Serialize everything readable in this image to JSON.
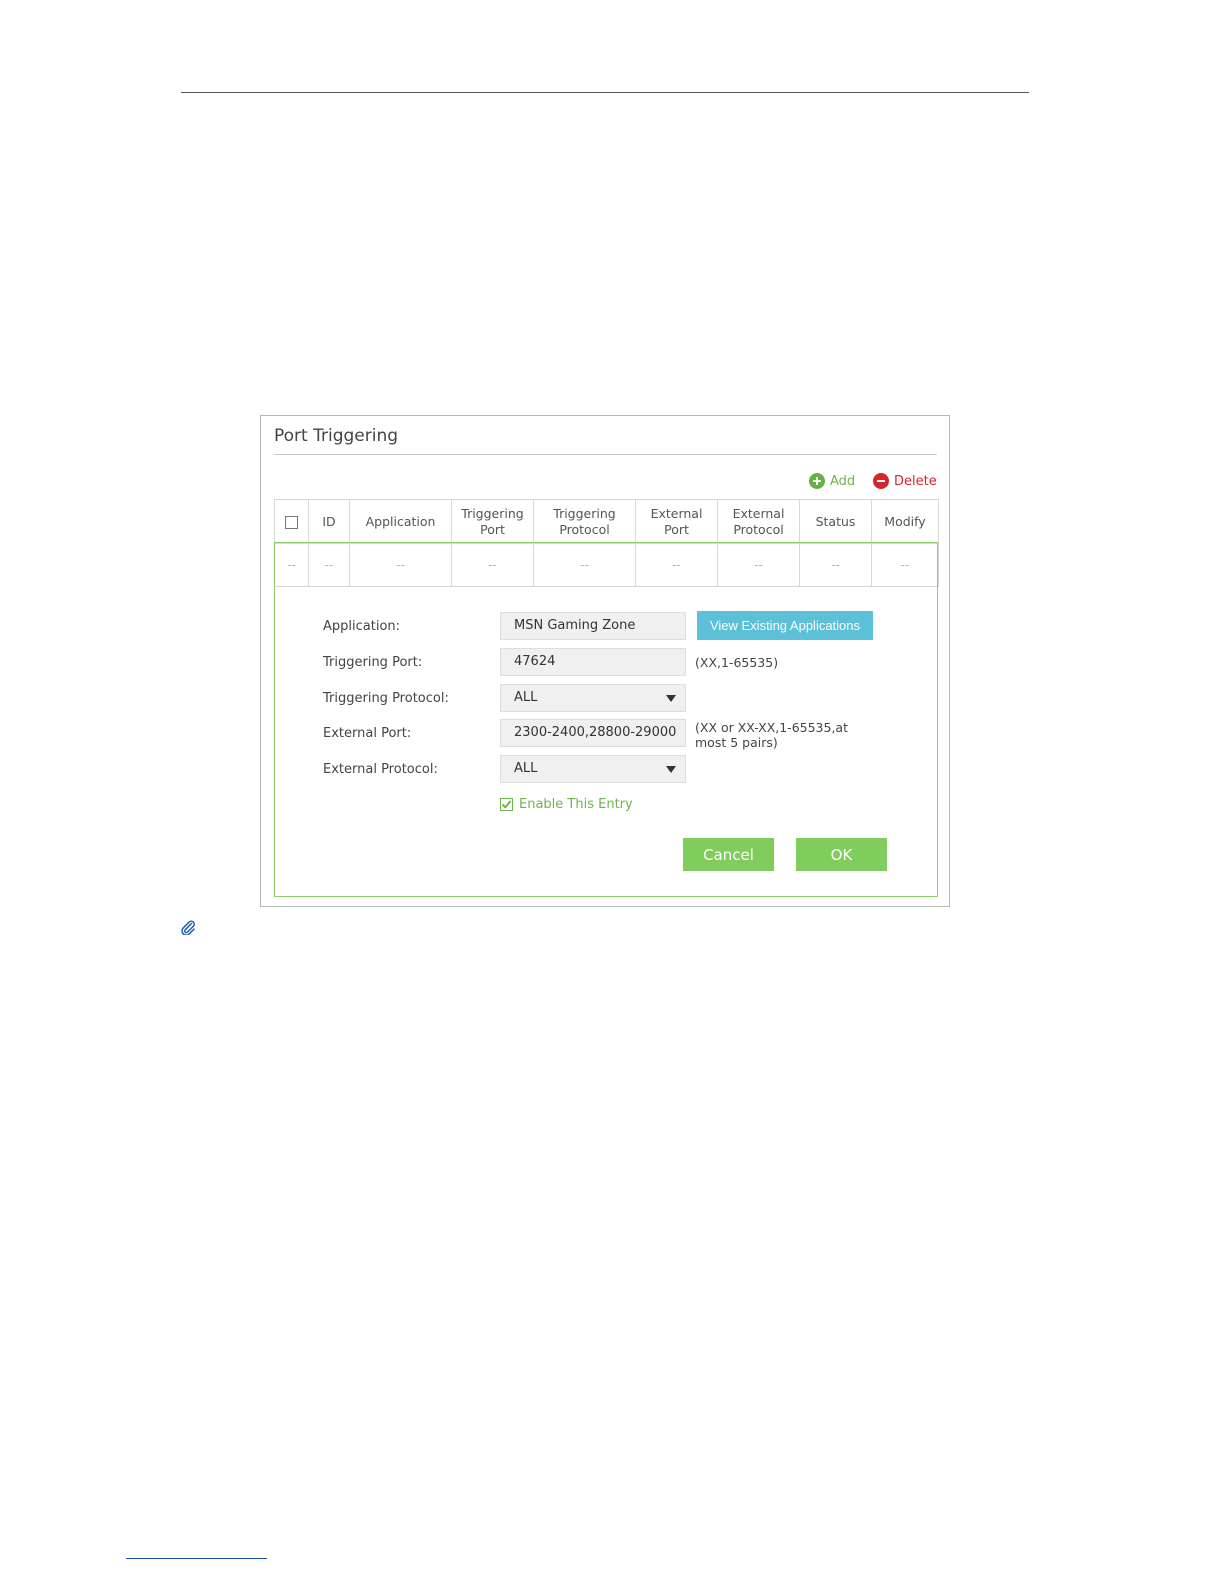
{
  "panel": {
    "title": "Port Triggering",
    "add_label": "Add",
    "delete_label": "Delete"
  },
  "table": {
    "headers": {
      "id": "ID",
      "application": "Application",
      "triggering_port_1": "Triggering",
      "triggering_port_2": "Port",
      "triggering_protocol_1": "Triggering",
      "triggering_protocol_2": "Protocol",
      "external_port_1": "External",
      "external_port_2": "Port",
      "external_protocol_1": "External",
      "external_protocol_2": "Protocol",
      "status": "Status",
      "modify": "Modify"
    },
    "empty_row": [
      "--",
      "--",
      "--",
      "--",
      "--",
      "--",
      "--",
      "--",
      "--"
    ]
  },
  "form": {
    "application_label": "Application:",
    "application_value": "MSN Gaming Zone",
    "view_apps_label": "View Existing Applications",
    "triggering_port_label": "Triggering Port:",
    "triggering_port_value": "47624",
    "triggering_port_hint": "(XX,1-65535)",
    "triggering_protocol_label": "Triggering Protocol:",
    "triggering_protocol_value": "ALL",
    "external_port_label": "External Port:",
    "external_port_value": "2300-2400,28800-29000",
    "external_port_hint_1": "(XX or XX-XX,1-65535,at",
    "external_port_hint_2": "most 5 pairs)",
    "external_protocol_label": "External Protocol:",
    "external_protocol_value": "ALL",
    "enable_label": "Enable This Entry",
    "enable_checked": true,
    "cancel_label": "Cancel",
    "ok_label": "OK"
  },
  "colors": {
    "accent_green": "#80cc5c",
    "delete_red": "#d5252f",
    "view_button_blue": "#5cc0d6",
    "edit_border_green": "#8ccf6a"
  },
  "icons": {
    "add": "plus-circle-icon",
    "delete": "minus-circle-icon",
    "note": "paperclip-icon",
    "select_arrow": "triangle-down-icon"
  }
}
